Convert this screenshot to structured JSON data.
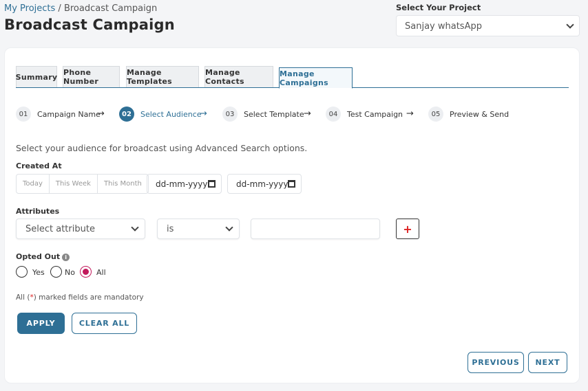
{
  "breadcrumb": {
    "parent": "My Projects",
    "separator": " / ",
    "current": "Broadcast Campaign"
  },
  "page_title": "Broadcast Campaign",
  "project": {
    "label": "Select Your Project",
    "selected": "Sanjay whatsApp"
  },
  "tabs": [
    {
      "label": "Summary",
      "active": false
    },
    {
      "label": "Phone Number",
      "active": false
    },
    {
      "label": "Manage Templates",
      "active": false
    },
    {
      "label": "Manage Contacts",
      "active": false
    },
    {
      "label": "Manage Campaigns",
      "active": true
    }
  ],
  "steps": [
    {
      "num": "01",
      "label": "Campaign Name"
    },
    {
      "num": "02",
      "label": "Select Audience",
      "active": true
    },
    {
      "num": "03",
      "label": "Select Template"
    },
    {
      "num": "04",
      "label": "Test Campaign"
    },
    {
      "num": "05",
      "label": "Preview & Send"
    }
  ],
  "step_arrow": "→",
  "intro_text": "Select your audience for broadcast using Advanced Search options.",
  "created_at": {
    "label": "Created At",
    "presets": [
      "Today",
      "This Week",
      "This Month"
    ],
    "from_placeholder": "dd-mm-yyyy",
    "to_placeholder": "dd-mm-yyyy"
  },
  "attributes": {
    "label": "Attributes",
    "attribute_select": "Select attribute",
    "operator_select": "is",
    "value": "",
    "add_button": "+"
  },
  "opted_out": {
    "label": "Opted Out",
    "info_icon": "i",
    "options": [
      {
        "label": "Yes",
        "checked": false
      },
      {
        "label": "No",
        "checked": false
      },
      {
        "label": "All",
        "checked": true
      }
    ]
  },
  "mandatory_note": {
    "prefix": "All (",
    "star": "*",
    "suffix": ") marked fields are mandatory"
  },
  "buttons": {
    "apply": "APPLY",
    "clear_all": "CLEAR ALL",
    "previous": "PREVIOUS",
    "next": "NEXT"
  },
  "colors": {
    "accent": "#2e6f95",
    "radio_selected": "#c2185b",
    "required": "#dd2222"
  }
}
